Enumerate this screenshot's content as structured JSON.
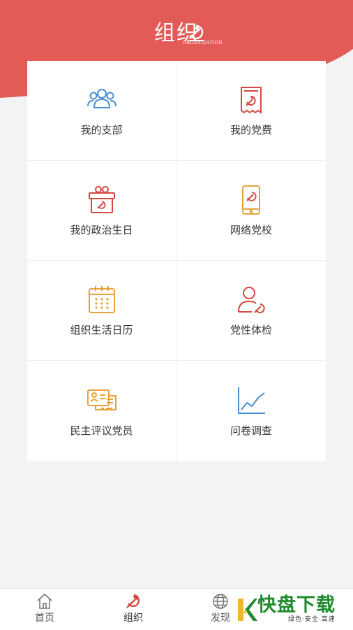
{
  "header": {
    "logo_text": "组织",
    "logo_subtext": "ORGANIZATION",
    "accent_color": "#e25b57"
  },
  "menu": [
    {
      "label": "我的支部",
      "icon": "people-group-icon"
    },
    {
      "label": "我的党费",
      "icon": "party-fee-receipt-icon"
    },
    {
      "label": "我的政治生日",
      "icon": "gift-icon"
    },
    {
      "label": "网络党校",
      "icon": "phone-school-icon"
    },
    {
      "label": "组织生活日历",
      "icon": "calendar-icon"
    },
    {
      "label": "党性体检",
      "icon": "person-checkup-icon"
    },
    {
      "label": "民主评议党员",
      "icon": "review-card-icon"
    },
    {
      "label": "问卷调查",
      "icon": "chart-trend-icon"
    }
  ],
  "tabbar": {
    "items": [
      {
        "label": "首页",
        "icon": "home-icon"
      },
      {
        "label": "组织",
        "icon": "party-emblem-icon",
        "active": true
      },
      {
        "label": "发现",
        "icon": "globe-icon"
      }
    ]
  },
  "watermark": {
    "brand": "快盘下载",
    "tagline": "绿色·安全·高速"
  }
}
